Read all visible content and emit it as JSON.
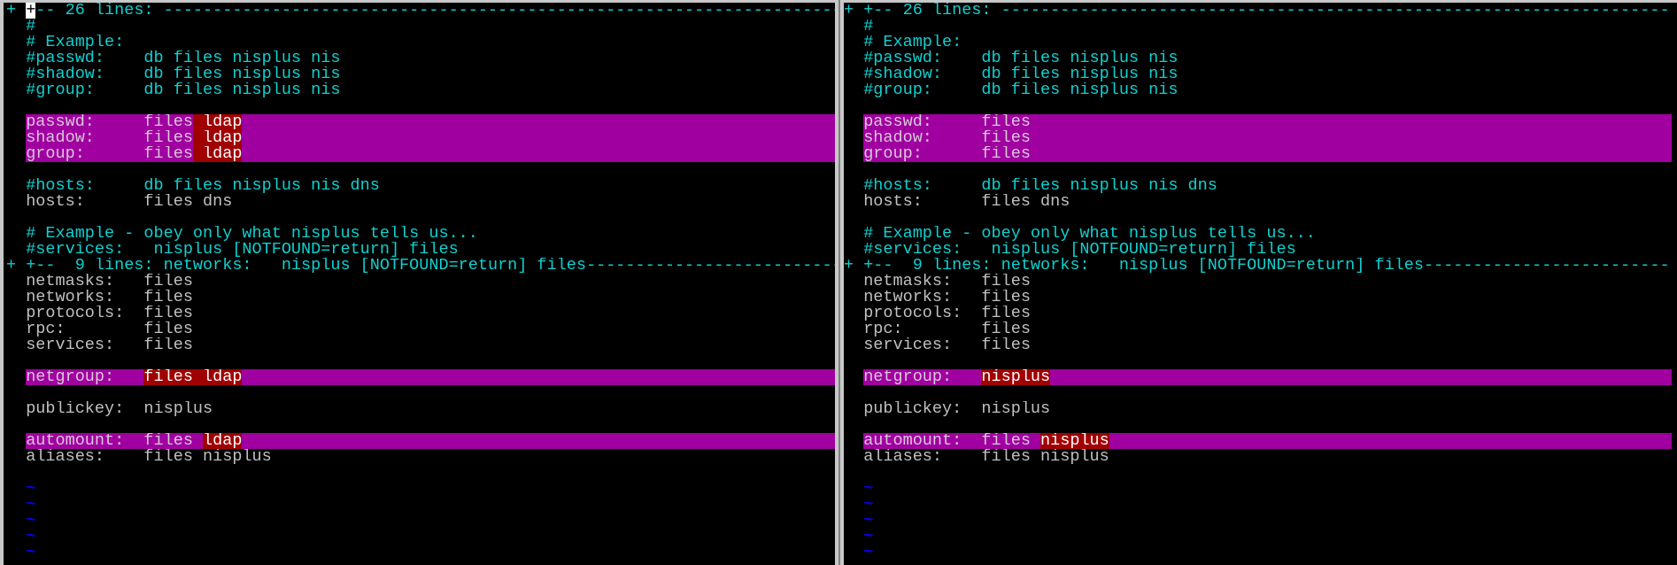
{
  "colors": {
    "comment": "#10d0d0",
    "normal": "#c0c0c0",
    "diff_add": "#a000a0",
    "diff_text": "#a00000",
    "filler": "#0000ff"
  },
  "fold_fill": "-",
  "panes": [
    {
      "id": "left",
      "rows": [
        {
          "k": "fold",
          "sign": "+",
          "t": "+-- 26 lines: ",
          "cursor": true
        },
        {
          "k": "comment",
          "t": "#"
        },
        {
          "k": "comment",
          "t": "# Example:"
        },
        {
          "k": "comment",
          "t": "#passwd:    db files nisplus nis"
        },
        {
          "k": "comment",
          "t": "#shadow:    db files nisplus nis"
        },
        {
          "k": "comment",
          "t": "#group:     db files nisplus nis"
        },
        {
          "k": "normal",
          "t": ""
        },
        {
          "k": "diff",
          "t": "passwd:     files",
          "c": " ldap"
        },
        {
          "k": "diff",
          "t": "shadow:     files",
          "c": " ldap"
        },
        {
          "k": "diff",
          "t": "group:      files",
          "c": " ldap"
        },
        {
          "k": "normal",
          "t": ""
        },
        {
          "k": "comment",
          "t": "#hosts:     db files nisplus nis dns"
        },
        {
          "k": "normal",
          "t": "hosts:      files dns"
        },
        {
          "k": "normal",
          "t": ""
        },
        {
          "k": "comment",
          "t": "# Example - obey only what nisplus tells us..."
        },
        {
          "k": "comment",
          "t": "#services:   nisplus [NOTFOUND=return] files"
        },
        {
          "k": "fold",
          "sign": "+",
          "t": "+--  9 lines: networks:   nisplus [NOTFOUND=return] files"
        },
        {
          "k": "normal",
          "t": "netmasks:   files"
        },
        {
          "k": "normal",
          "t": "networks:   files"
        },
        {
          "k": "normal",
          "t": "protocols:  files"
        },
        {
          "k": "normal",
          "t": "rpc:        files"
        },
        {
          "k": "normal",
          "t": "services:   files"
        },
        {
          "k": "normal",
          "t": ""
        },
        {
          "k": "diff",
          "t": "netgroup:   ",
          "c": "files ldap"
        },
        {
          "k": "normal",
          "t": ""
        },
        {
          "k": "normal",
          "t": "publickey:  nisplus"
        },
        {
          "k": "normal",
          "t": ""
        },
        {
          "k": "diff",
          "t": "automount:  files ",
          "c": "ldap"
        },
        {
          "k": "normal",
          "t": "aliases:    files nisplus"
        },
        {
          "k": "normal",
          "t": ""
        },
        {
          "k": "tilde",
          "t": "~"
        },
        {
          "k": "tilde",
          "t": "~"
        },
        {
          "k": "tilde",
          "t": "~"
        },
        {
          "k": "tilde",
          "t": "~"
        },
        {
          "k": "tilde",
          "t": "~"
        }
      ]
    },
    {
      "id": "right",
      "rows": [
        {
          "k": "fold",
          "sign": "+",
          "t": "+-- 26 lines: "
        },
        {
          "k": "comment",
          "t": "#"
        },
        {
          "k": "comment",
          "t": "# Example:"
        },
        {
          "k": "comment",
          "t": "#passwd:    db files nisplus nis"
        },
        {
          "k": "comment",
          "t": "#shadow:    db files nisplus nis"
        },
        {
          "k": "comment",
          "t": "#group:     db files nisplus nis"
        },
        {
          "k": "normal",
          "t": ""
        },
        {
          "k": "diff",
          "t": "passwd:     files"
        },
        {
          "k": "diff",
          "t": "shadow:     files"
        },
        {
          "k": "diff",
          "t": "group:      files"
        },
        {
          "k": "normal",
          "t": ""
        },
        {
          "k": "comment",
          "t": "#hosts:     db files nisplus nis dns"
        },
        {
          "k": "normal",
          "t": "hosts:      files dns"
        },
        {
          "k": "normal",
          "t": ""
        },
        {
          "k": "comment",
          "t": "# Example - obey only what nisplus tells us..."
        },
        {
          "k": "comment",
          "t": "#services:   nisplus [NOTFOUND=return] files"
        },
        {
          "k": "fold",
          "sign": "+",
          "t": "+--  9 lines: networks:   nisplus [NOTFOUND=return] files"
        },
        {
          "k": "normal",
          "t": "netmasks:   files"
        },
        {
          "k": "normal",
          "t": "networks:   files"
        },
        {
          "k": "normal",
          "t": "protocols:  files"
        },
        {
          "k": "normal",
          "t": "rpc:        files"
        },
        {
          "k": "normal",
          "t": "services:   files"
        },
        {
          "k": "normal",
          "t": ""
        },
        {
          "k": "diff",
          "t": "netgroup:   ",
          "c": "nisplus"
        },
        {
          "k": "normal",
          "t": ""
        },
        {
          "k": "normal",
          "t": "publickey:  nisplus"
        },
        {
          "k": "normal",
          "t": ""
        },
        {
          "k": "diff",
          "t": "automount:  files ",
          "c": "nisplus"
        },
        {
          "k": "normal",
          "t": "aliases:    files nisplus"
        },
        {
          "k": "normal",
          "t": ""
        },
        {
          "k": "tilde",
          "t": "~"
        },
        {
          "k": "tilde",
          "t": "~"
        },
        {
          "k": "tilde",
          "t": "~"
        },
        {
          "k": "tilde",
          "t": "~"
        },
        {
          "k": "tilde",
          "t": "~"
        }
      ]
    }
  ]
}
